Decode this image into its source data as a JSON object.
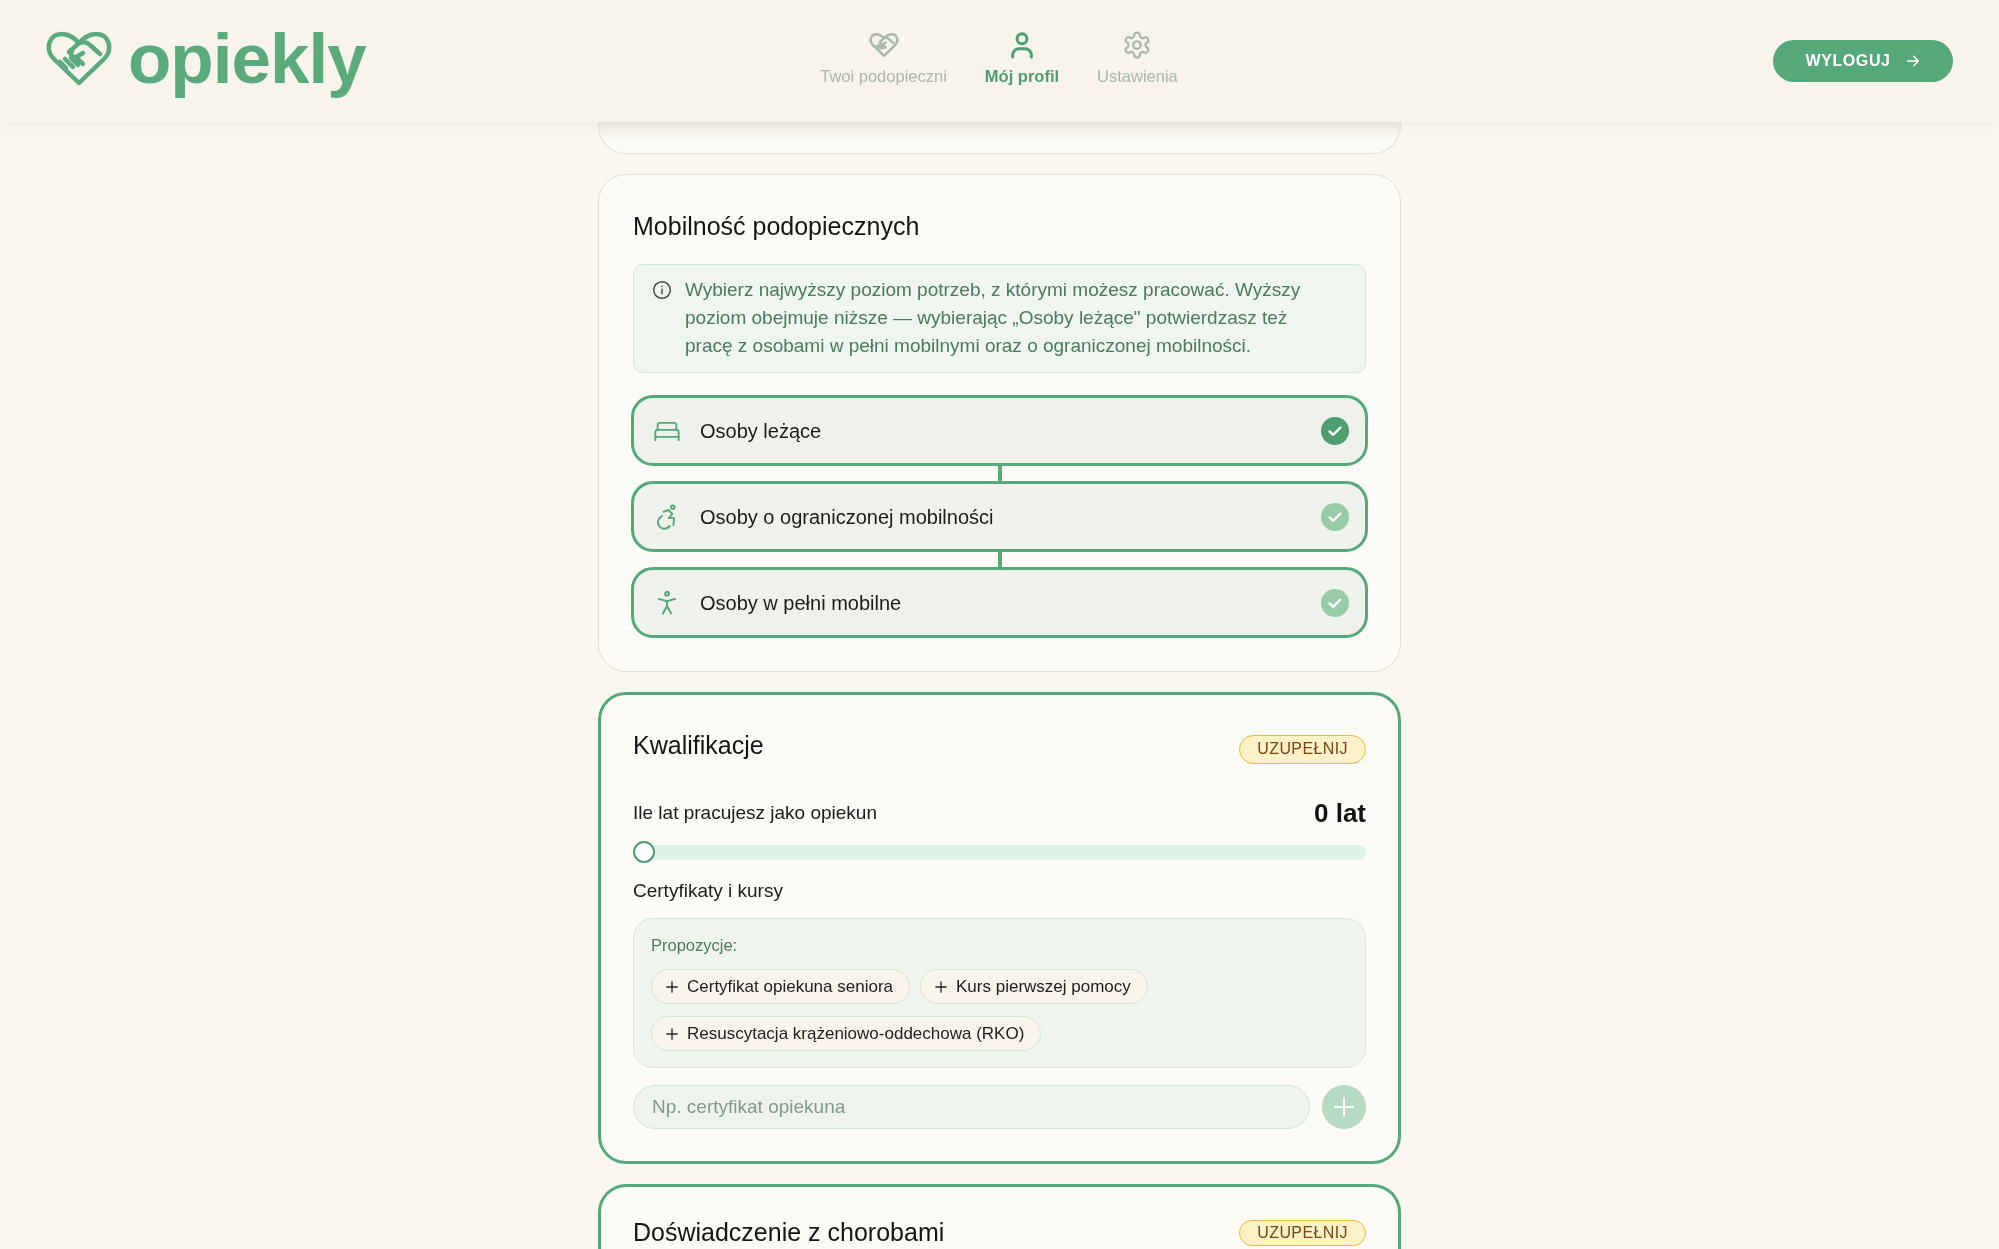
{
  "header": {
    "logo_text": "opiekly",
    "nav": [
      {
        "label": "Twoi podopieczni",
        "selected": false
      },
      {
        "label": "Mój profil",
        "selected": true
      },
      {
        "label": "Ustawienia",
        "selected": false
      }
    ],
    "logout_button": "WYLOGUJ"
  },
  "mobility": {
    "title": "Mobilność podopiecznych",
    "needs_completion": false,
    "info": "Wybierz najwyższy poziom potrzeb, z którymi możesz pracować. Wyższy poziom obejmuje niższe — wybierając „Osoby leżące\" potwierdzasz też pracę z osobami w pełni mobilnymi oraz o ograniczonej mobilności.",
    "levels": [
      {
        "label": "Osoby leżące",
        "selected": true,
        "checked": true
      },
      {
        "label": "Osoby o ograniczonej mobilności",
        "selected": false,
        "checked": true
      },
      {
        "label": "Osoby w pełni mobilne",
        "selected": false,
        "checked": true
      }
    ]
  },
  "qualifications": {
    "title": "Kwalifikacje",
    "needs_completion": true,
    "badge": "UZUPEŁNIJ",
    "experience": {
      "label": "Ile lat pracujesz jako opiekun",
      "reading": "0 lat",
      "level": 0
    },
    "certificates": {
      "label": "Certyfikaty i kursy",
      "suggestions_label": "Propozycje:",
      "suggestions": [
        "Certyfikat opiekuna seniora",
        "Kurs pierwszej pomocy",
        "Resuscytacja krążeniowo-oddechowa (RKO)"
      ],
      "input": {
        "placeholder": "Np. certyfikat opiekuna"
      },
      "add_button": {
        "disabled": true
      }
    }
  },
  "diseases": {
    "title": "Doświadczenie z chorobami",
    "needs_completion": true,
    "badge": "UZUPEŁNIJ"
  }
}
